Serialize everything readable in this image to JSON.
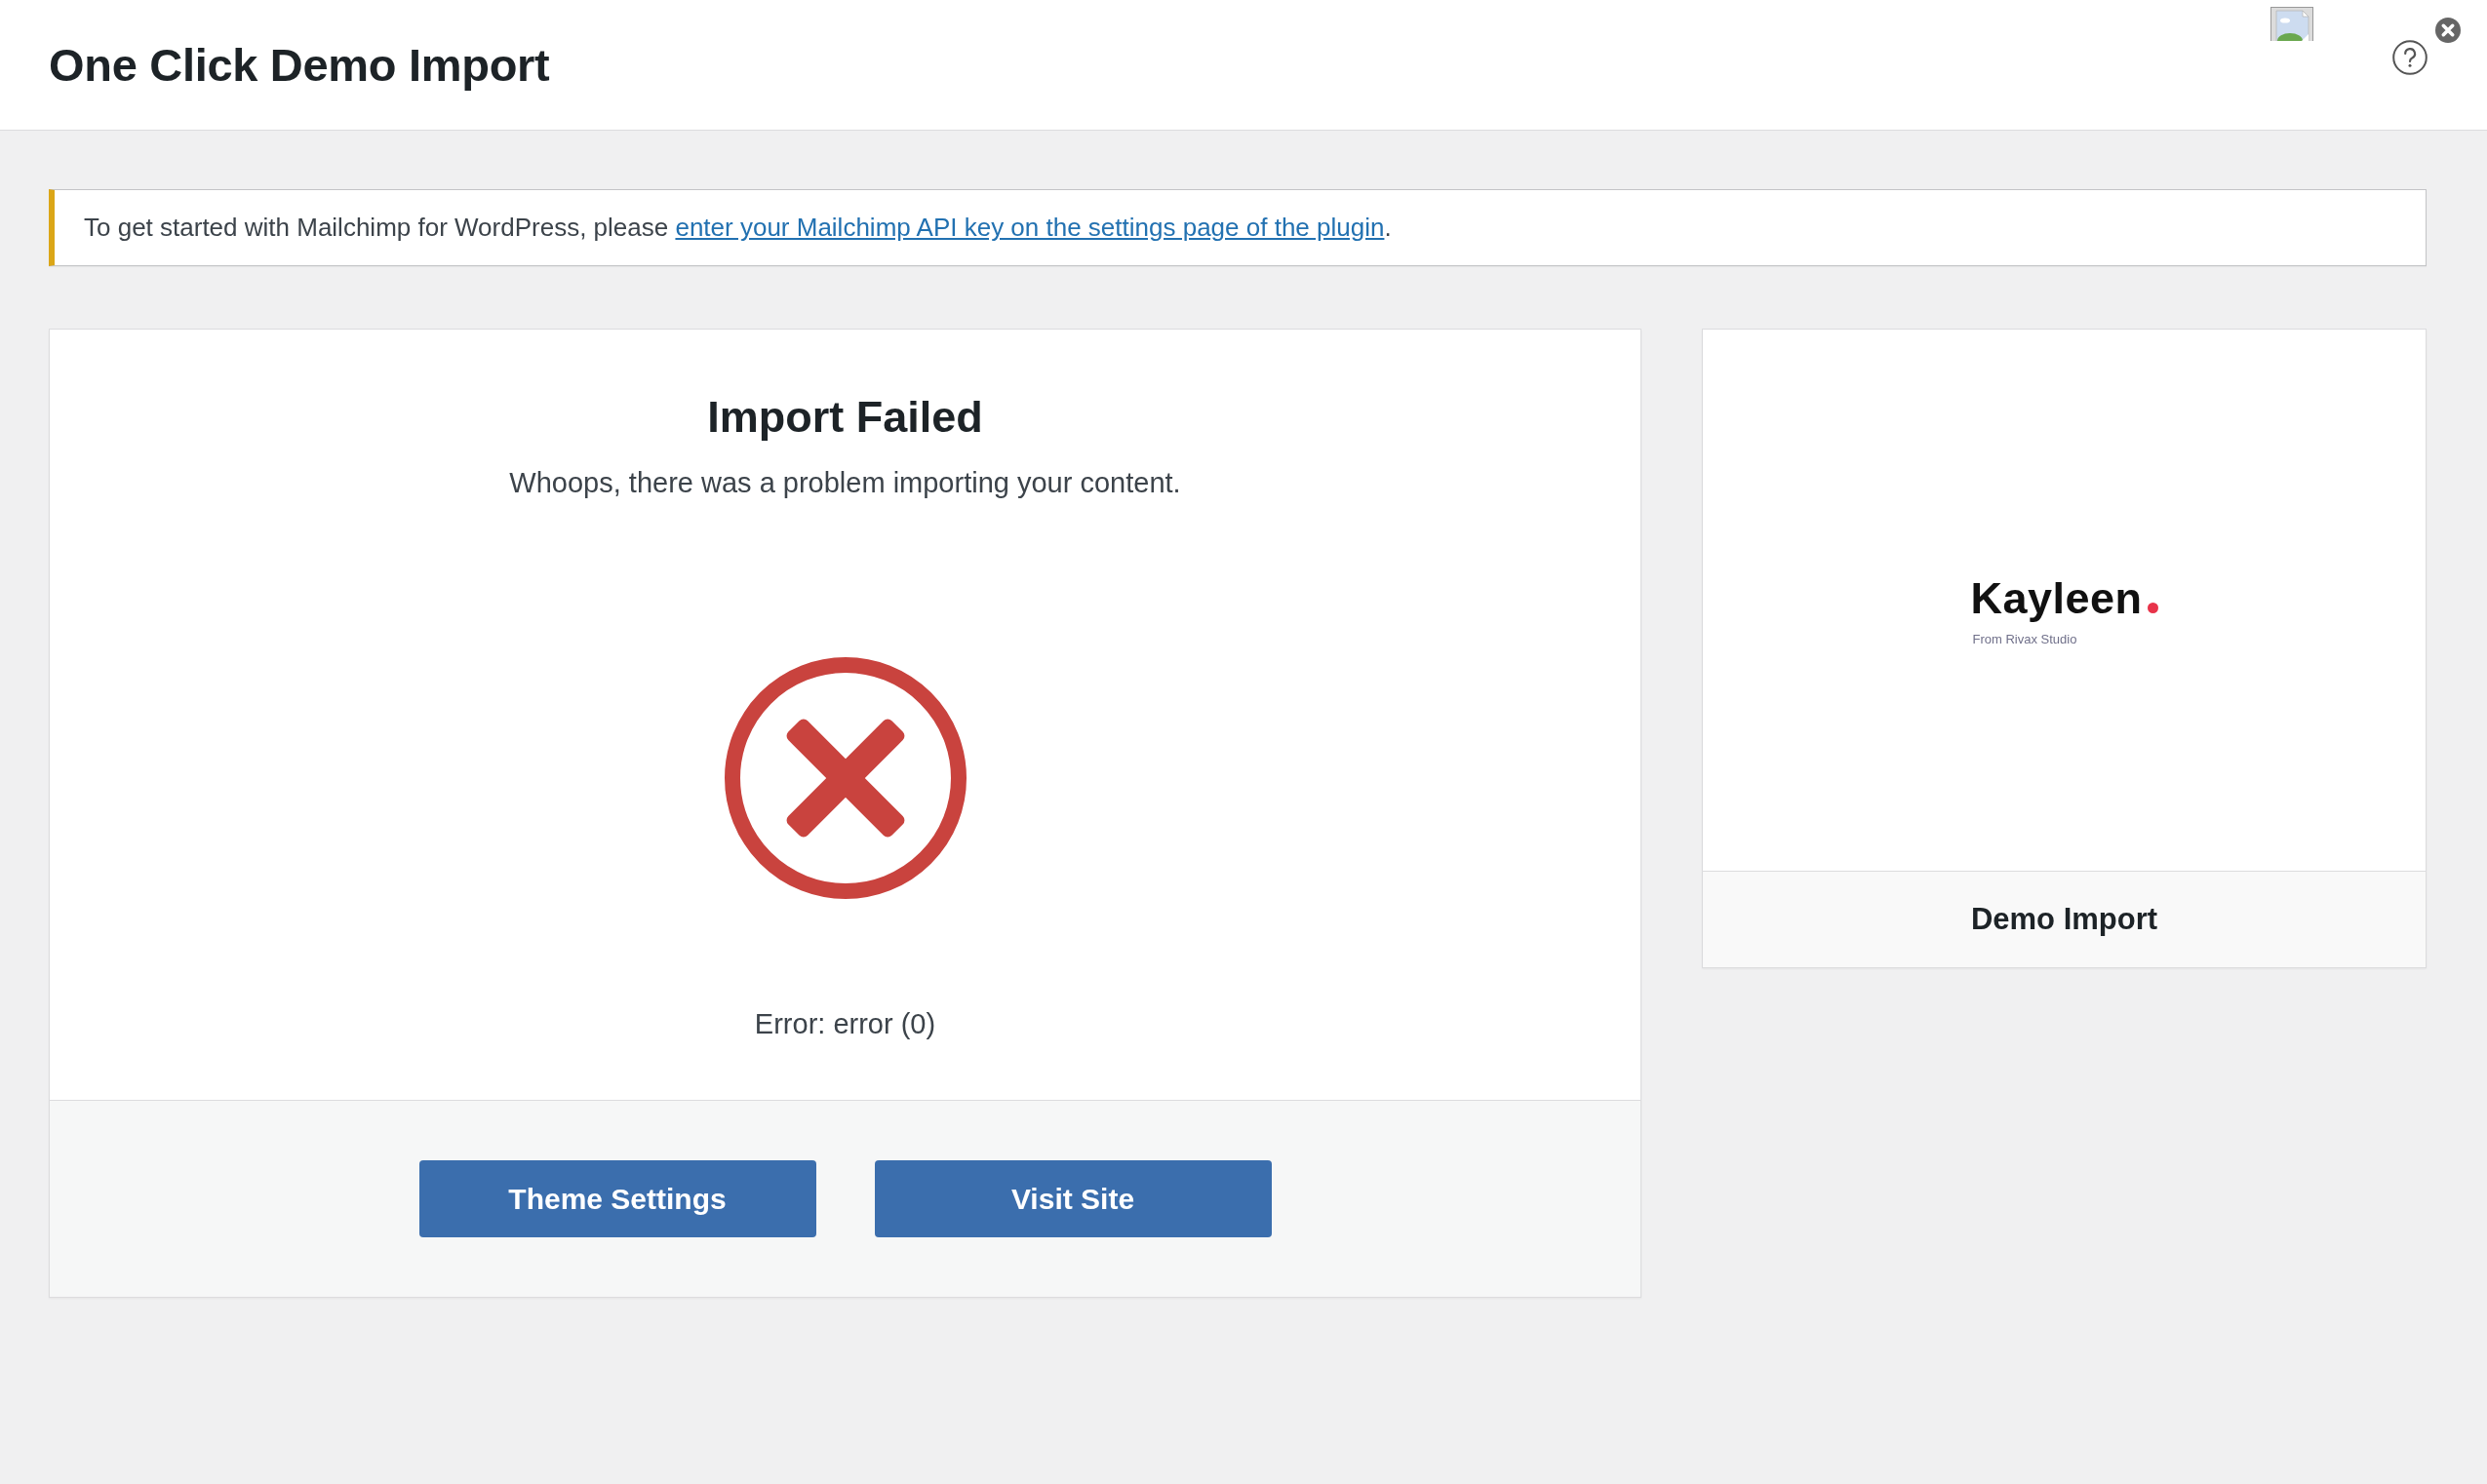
{
  "header": {
    "title": "One Click Demo Import"
  },
  "notice": {
    "text_before": "To get started with Mailchimp for WordPress, please",
    "link": "enter your Mailchimp API key on the settings page of the plugin",
    "text_after": "."
  },
  "result": {
    "kind": "error",
    "title": "Import Failed",
    "message": "Whoops, there was a problem importing your content.",
    "error": "Error: error (0)",
    "buttons": [
      "Theme Settings",
      "Visit Site"
    ]
  },
  "demo": {
    "logo": {
      "name": "Kayleen",
      "tagline": "From Rivax Studio"
    },
    "title": "Demo Import"
  }
}
